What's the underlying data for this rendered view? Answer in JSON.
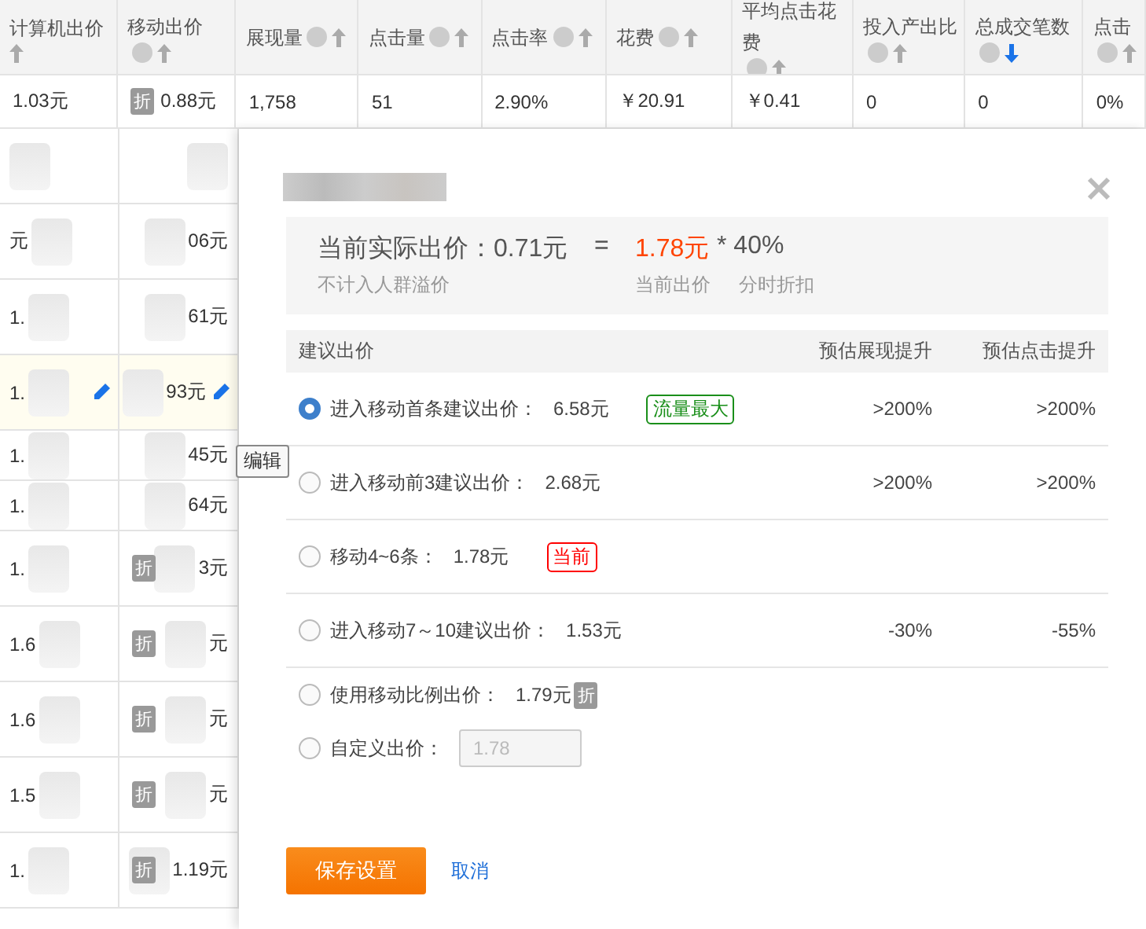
{
  "table": {
    "columns": [
      {
        "label": "计算机出价",
        "help": false,
        "sorted": false
      },
      {
        "label": "移动出价",
        "help": true,
        "sorted": false
      },
      {
        "label": "展现量",
        "help": true,
        "sorted": false
      },
      {
        "label": "点击量",
        "help": true,
        "sorted": false
      },
      {
        "label": "点击率",
        "help": true,
        "sorted": false
      },
      {
        "label": "花费",
        "help": true,
        "sorted": false
      },
      {
        "label": "平均点击花费",
        "help": true,
        "sorted": false
      },
      {
        "label": "投入产出比",
        "help": true,
        "sorted": false
      },
      {
        "label": "总成交笔数",
        "help": true,
        "sorted": true
      },
      {
        "label": "点击",
        "help": true,
        "sorted": false
      }
    ],
    "first_row": [
      {
        "text": "1.03元"
      },
      {
        "text": "0.88元",
        "discount": "折"
      },
      {
        "text": "1,758"
      },
      {
        "text": "51"
      },
      {
        "text": "2.90%"
      },
      {
        "text": "￥20.91"
      },
      {
        "text": "￥0.41"
      },
      {
        "text": "0"
      },
      {
        "text": "0"
      },
      {
        "text": "0%"
      }
    ],
    "rows": [
      {
        "highlighted": false
      },
      {
        "c1": "元",
        "c2": "06元",
        "highlighted": false
      },
      {
        "c1": "1.",
        "c2": "61元",
        "highlighted": false
      },
      {
        "c1": "1.",
        "c2": "93元",
        "highlighted": true
      },
      {
        "c1": "1.",
        "c2": "45元",
        "highlighted": false
      },
      {
        "c1": "1.",
        "c2": "64元",
        "highlighted": false
      },
      {
        "c1": "1.",
        "c2": "3元",
        "discount": "折",
        "highlighted": false
      },
      {
        "c1": "1.6",
        "c2": "元",
        "discount": "折",
        "highlighted": false
      },
      {
        "c1": "1.6",
        "c2": "元",
        "discount": "折",
        "highlighted": false
      },
      {
        "c1": "1.5",
        "c2": "元",
        "discount": "折",
        "highlighted": false
      },
      {
        "c1": "1.",
        "c2": "1.19元",
        "discount": "折",
        "highlighted": false
      }
    ]
  },
  "tooltip": "编辑",
  "dialog": {
    "summary": {
      "actual": "当前实际出价：0.71元",
      "equals": "=",
      "current": "1.78元",
      "factor": "* 40%",
      "note": "不计入人群溢价",
      "current_label": "当前出价",
      "factor_label": "分时折扣"
    },
    "columns": [
      "建议出价",
      "预估展现提升",
      "预估点击提升"
    ],
    "options": [
      {
        "label": "进入移动首条建议出价：",
        "price": "6.58元",
        "badge": {
          "text": "流量最大",
          "kind": "max"
        },
        "impressions": ">200%",
        "clicks": ">200%",
        "selected": true,
        "compact": false
      },
      {
        "label": "进入移动前3建议出价：",
        "price": "2.68元",
        "impressions": ">200%",
        "clicks": ">200%",
        "selected": false,
        "compact": false
      },
      {
        "label": "移动4~6条：",
        "price": "1.78元",
        "badge": {
          "text": "当前",
          "kind": "current"
        },
        "selected": false,
        "compact": false
      },
      {
        "label": "进入移动7～10建议出价：",
        "price": "1.53元",
        "impressions": "-30%",
        "clicks": "-55%",
        "selected": false,
        "compact": false
      },
      {
        "label": "使用移动比例出价：",
        "price": "1.79元",
        "discount": "折",
        "selected": false,
        "compact": true
      },
      {
        "label": "自定义出价：",
        "field": {
          "value": "1.78",
          "disabled": true
        },
        "selected": false,
        "compact": true
      }
    ],
    "save": "保存设置",
    "cancel": "取消"
  }
}
